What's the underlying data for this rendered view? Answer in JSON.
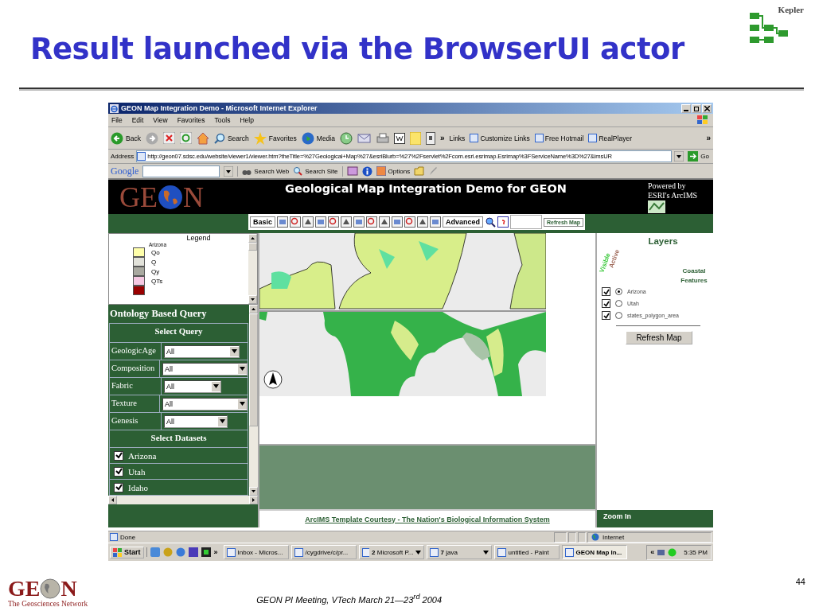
{
  "slide": {
    "title": "Result launched via the BrowserUI actor",
    "logo_text": "Kepler",
    "footer": "GEON PI Meeting, VTech March 21—23$^{rd}$ 2004",
    "page_number": "44",
    "footer_logo": {
      "left": "GE",
      "right": "N",
      "tagline": "The Geosciences Network"
    }
  },
  "browser": {
    "title": "GEON Map Integration Demo - Microsoft Internet Explorer",
    "menu": [
      "File",
      "Edit",
      "View",
      "Favorites",
      "Tools",
      "Help"
    ],
    "toolbar": {
      "back": "Back",
      "search": "Search",
      "favorites": "Favorites",
      "media": "Media",
      "chevron": "»",
      "links": "Links",
      "link_items": [
        "Customize Links",
        "Free Hotmail",
        "RealPlayer"
      ],
      "end_chevron": "»"
    },
    "address": {
      "label": "Address",
      "url": "http://geon07.sdsc.edu/website/viewer1/viewer.htm?theTitle=%27Geological+Map%27&esriBlurb=%27%2Fservlet%2Fcom.esri.esrimap.Esrimap%3FServiceName%3D%27&imsUR",
      "go": "Go"
    },
    "google_bar": {
      "logo": "Google",
      "search_web": "Search Web",
      "search_site": "Search Site",
      "options": "Options"
    },
    "page": {
      "header": {
        "logo_left": "GE",
        "logo_right": "N",
        "title": "Geological Map Integration Demo for GEON",
        "powered": "Powered by",
        "powered_by": "ESRI's ArcIMS"
      },
      "tools": {
        "basic": "Basic",
        "advanced": "Advanced",
        "refresh": "Refresh Map"
      },
      "legend": {
        "title": "Legend",
        "group": "Arizona",
        "items": [
          {
            "label": "Qo",
            "color": "#ffffaa"
          },
          {
            "label": "Q",
            "color": "#e2e2da"
          },
          {
            "label": "Qy",
            "color": "#a9a9a0"
          },
          {
            "label": "QTs",
            "color": "#f6c8e2"
          },
          {
            "color": "#9a0000"
          }
        ]
      },
      "query": {
        "title": "Ontology Based Query",
        "select_query": "Select Query",
        "fields": [
          {
            "label": "GeologicAge",
            "value": "All"
          },
          {
            "label": "Composition",
            "value": "All"
          },
          {
            "label": "Fabric",
            "value": "All"
          },
          {
            "label": "Texture",
            "value": "All"
          },
          {
            "label": "Genesis",
            "value": "All"
          }
        ],
        "select_datasets": "Select Datasets",
        "datasets": [
          {
            "label": "Arizona",
            "checked": true
          },
          {
            "label": "Utah",
            "checked": true
          },
          {
            "label": "Idaho",
            "checked": true
          }
        ]
      },
      "layers": {
        "title": "Layers",
        "visible": "Visible",
        "active": "Active",
        "coastal": "Coastal Features",
        "items": [
          {
            "label": "Arizona",
            "visible": true,
            "active": true
          },
          {
            "label": "Utah",
            "visible": true,
            "active": false
          },
          {
            "label": "states_polygon_area",
            "visible": true,
            "active": false
          }
        ],
        "refresh": "Refresh Map"
      },
      "credit": "ArcIMS Template Courtesy - The Nation's Biological Information System",
      "mode": "Zoom In"
    },
    "status": {
      "text": "Done",
      "zone": "Internet"
    },
    "taskbar": {
      "start": "Start",
      "chevron": "»",
      "tasks": [
        {
          "label": "Inbox - Micros...",
          "grouped": false,
          "selected": false
        },
        {
          "label": "/cygdrive/c/pr...",
          "grouped": false,
          "selected": false
        },
        {
          "label": "**2** Microsoft P...",
          "grouped": true,
          "selected": false
        },
        {
          "label": "**7** java",
          "grouped": true,
          "selected": false
        },
        {
          "label": "untitled - Paint",
          "grouped": false,
          "selected": false
        },
        {
          "label": "GEON Map In...",
          "grouped": false,
          "selected": true
        }
      ],
      "tray_chevron": "«",
      "clock": "5:35 PM"
    }
  }
}
